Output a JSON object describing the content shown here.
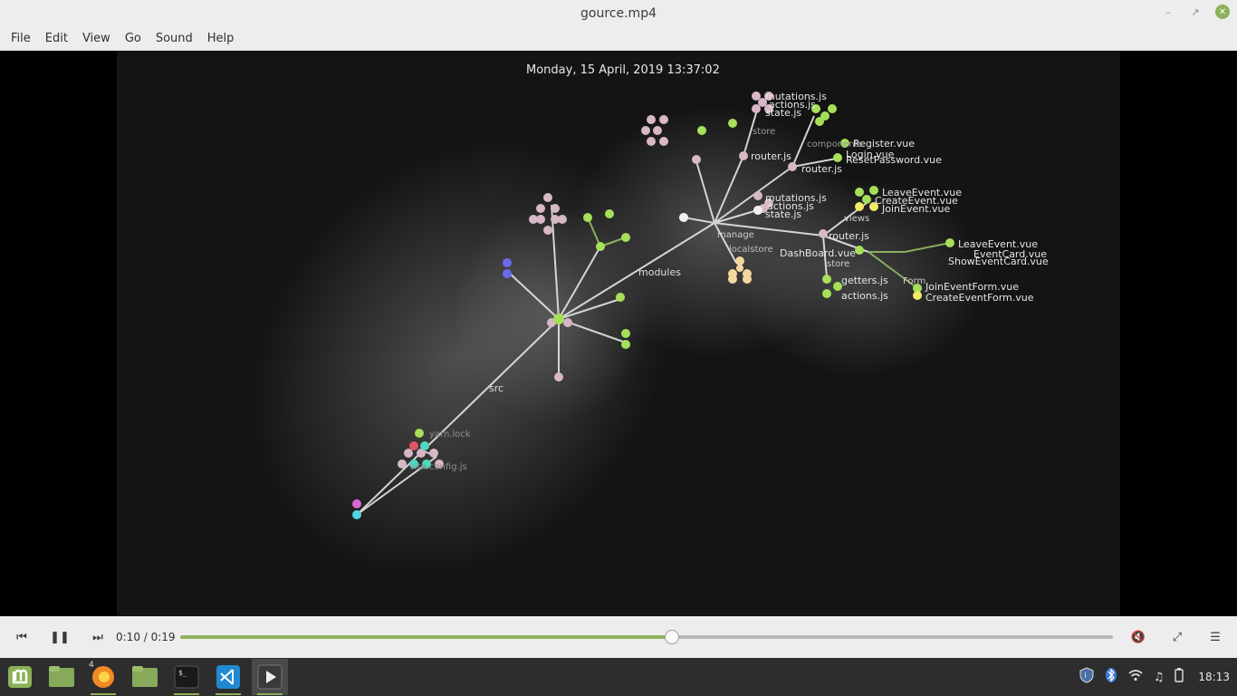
{
  "window": {
    "title": "gource.mp4"
  },
  "menu": [
    "File",
    "Edit",
    "View",
    "Go",
    "Sound",
    "Help"
  ],
  "video": {
    "timestamp": "Monday, 15 April, 2019 13:37:02",
    "labels": {
      "src": "src",
      "modules": "modules",
      "store1": "store",
      "store2": "store",
      "views": "views",
      "router1": "router.js",
      "router2": "router.js",
      "router3": "router.js",
      "mutations1": "mutations.js",
      "actions1": "actions.js",
      "state1": "state.js",
      "mutations2": "mutations.js",
      "actions2": "actions.js",
      "state2": "state.js",
      "getters": "getters.js",
      "actions3": "actions.js",
      "register": "Register.vue",
      "login": "Login.vue",
      "resetpw": "ResetPassword.vue",
      "leave1": "LeaveEvent.vue",
      "create1": "CreateEvent.vue",
      "join1": "JoinEvent.vue",
      "leave2": "LeaveEvent.vue",
      "eventcard": "EventCard.vue",
      "showevent": "ShowEventCard.vue",
      "dashboard": "DashBoard.vue",
      "joinform": "JoinEventForm.vue",
      "createform": "CreateEventForm.vue",
      "form": "Form",
      "yarnlock": "yarn.lock",
      "viteconfig": "vite.config.js",
      "components": "components",
      "manage": "manage",
      "localstore": "localstore"
    }
  },
  "player": {
    "time": "0:10 / 0:19",
    "progress": 0.527
  },
  "taskbar": {
    "badge": "4",
    "apps": [
      "mint-menu",
      "files",
      "firefox",
      "files",
      "terminal",
      "vscode",
      "video-player"
    ]
  },
  "tray": {
    "clock": "18:13"
  },
  "colors": {
    "accent": "#8bb158",
    "background": "#141414"
  }
}
